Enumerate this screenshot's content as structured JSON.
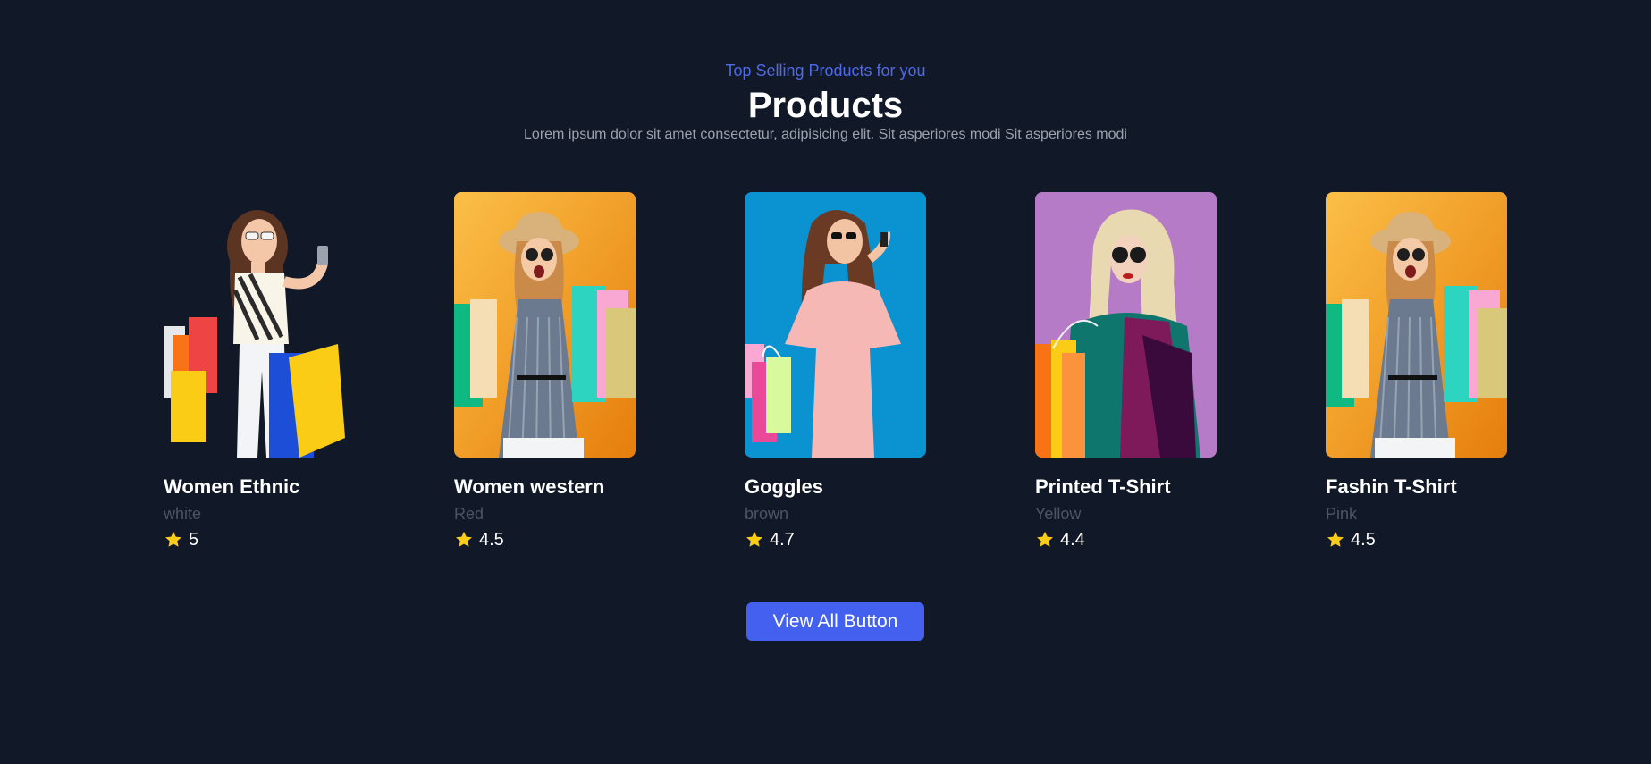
{
  "section": {
    "eyebrow": "Top Selling Products for you",
    "title": "Products",
    "subtitle": "Lorem ipsum dolor sit amet consectetur, adipisicing elit. Sit asperiores modi Sit asperiores modi"
  },
  "products": [
    {
      "name": "Women Ethnic",
      "color": "white",
      "rating": "5",
      "image_bg": "transparent",
      "image_icon": "woman-with-shopping-bags-photo"
    },
    {
      "name": "Women western",
      "color": "Red",
      "rating": "4.5",
      "image_bg": "#f59e0b",
      "image_icon": "woman-with-hat-shopping-bags-photo"
    },
    {
      "name": "Goggles",
      "color": "brown",
      "rating": "4.7",
      "image_bg": "#0891d1",
      "image_icon": "woman-in-pink-dress-photo"
    },
    {
      "name": "Printed T-Shirt",
      "color": "Yellow",
      "rating": "4.4",
      "image_bg": "#b57bc6",
      "image_icon": "woman-in-jacket-shopping-bags-photo"
    },
    {
      "name": "Fashin T-Shirt",
      "color": "Pink",
      "rating": "4.5",
      "image_bg": "#f59e0b",
      "image_icon": "woman-with-hat-shopping-bags-photo"
    }
  ],
  "view_all": {
    "label": "View All Button"
  },
  "colors": {
    "background": "#111827",
    "accent": "#4361ee",
    "eyebrow": "#4f6ae8",
    "star": "#facc15"
  }
}
